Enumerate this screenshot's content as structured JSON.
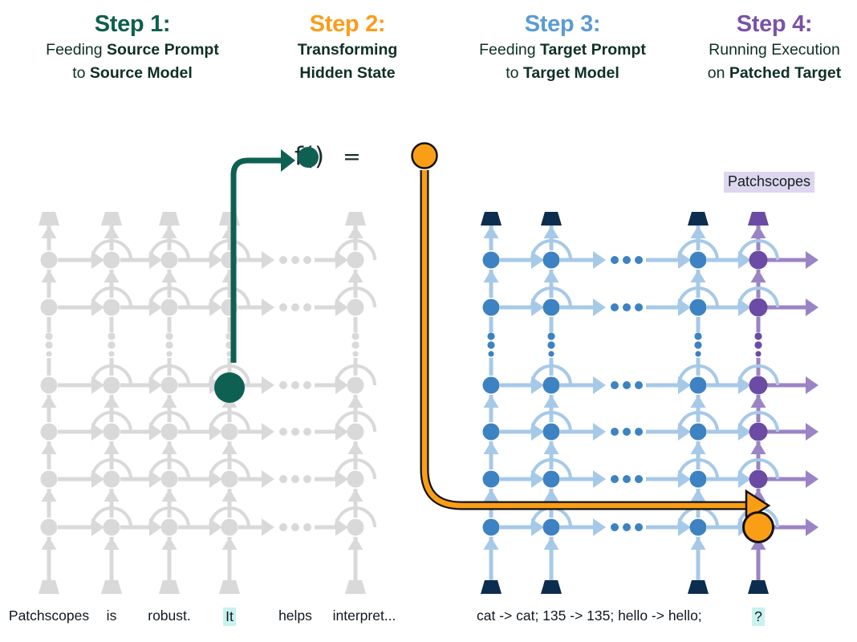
{
  "headers": [
    {
      "step": "Step 1:",
      "color": "#0e5f4e",
      "line1_pre": "Feeding ",
      "line1_bold": "Source Prompt",
      "line2_pre": "to ",
      "line2_bold": "Source Model"
    },
    {
      "step": "Step 2:",
      "color": "#f99d1c",
      "line1_pre": "",
      "line1_bold": "Transforming",
      "line2_pre": "",
      "line2_bold": "Hidden State"
    },
    {
      "step": "Step 3:",
      "color": "#5b9bd5",
      "line1_pre": "Feeding ",
      "line1_bold": "Target Prompt",
      "line2_pre": "to ",
      "line2_bold": "Target Model"
    },
    {
      "step": "Step 4:",
      "color": "#7b52a8",
      "line1_pre": "Running Execution",
      "line1_bold": "",
      "line2_pre": "on ",
      "line2_bold": "Patched Target"
    }
  ],
  "formula": {
    "fn_open": "f(",
    "fn_close": ")",
    "equals": "=",
    "source_dot_color": "#0e6152",
    "target_dot_color": "#fa9e15"
  },
  "patchscopes_tag": {
    "label": "Patchscopes",
    "bg": "#ddd6ee"
  },
  "source_prompt": {
    "tokens": [
      "Patchscopes",
      "is",
      "robust.",
      "It",
      "helps",
      "interpret..."
    ],
    "highlight_index": 3,
    "highlight_color": "#c9f2ec"
  },
  "target_prompt": {
    "tokens": [
      "cat -> cat; 135 -> 135; hello -> hello;",
      "?"
    ],
    "highlight_index": 1,
    "highlight_color": "#c9f2ec"
  },
  "palette": {
    "grey": "#d9d9d9",
    "grey_light": "#e2e2e2",
    "blue": "#3d82c2",
    "blue_light": "#a7c9e8",
    "navy": "#0d2d4e",
    "purple": "#6b4ba3",
    "purple_light": "#9b84c4",
    "teal": "#0e6152",
    "orange": "#fa9e15",
    "orange_stroke": "#111111"
  },
  "diagram": {
    "source_grid_label": "source transformer grid",
    "target_grid_label": "target transformer grid",
    "source_columns": 6,
    "target_columns": 5,
    "rows": 7,
    "patched_node_label": "patched hidden state",
    "extracted_node_label": "extracted hidden state"
  }
}
